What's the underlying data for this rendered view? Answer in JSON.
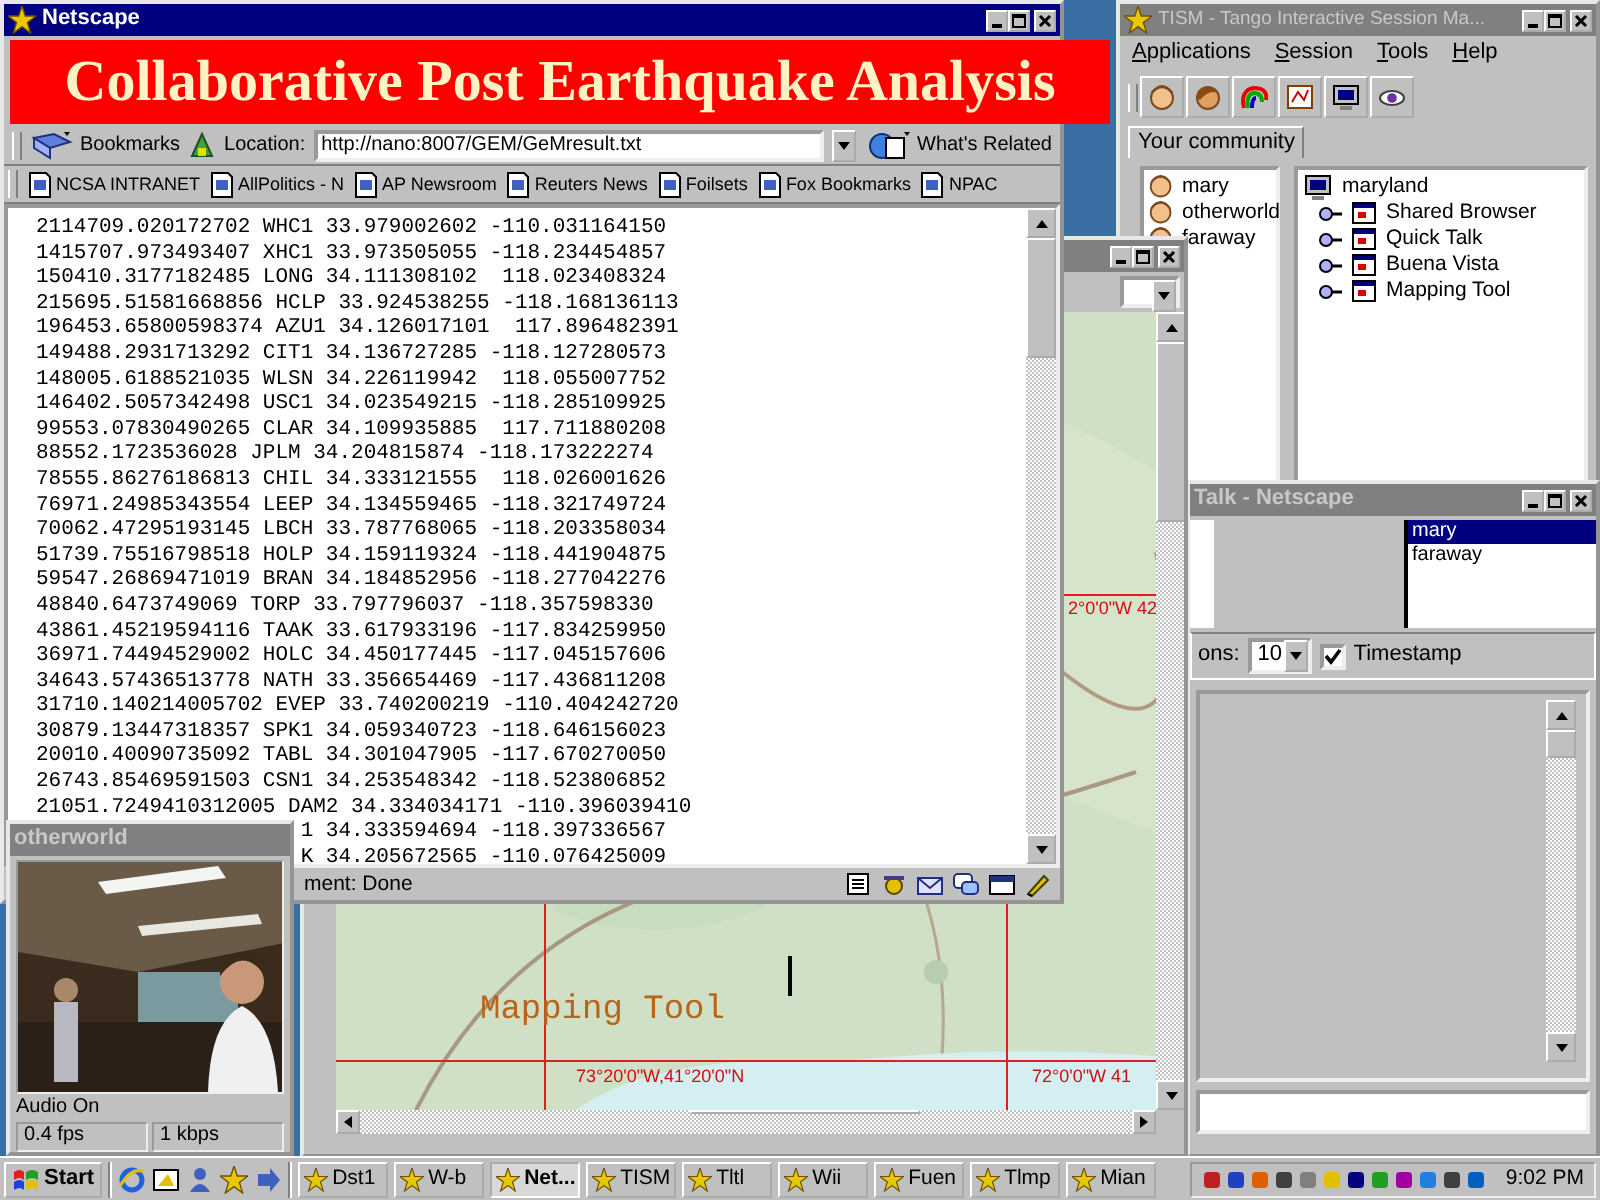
{
  "browser_window": {
    "title": "Netscape",
    "active": true,
    "banner": "Collaborative Post Earthquake Analysis",
    "toolbar": {
      "bookmarks": "Bookmarks",
      "location_label": "Location:",
      "url": "http://nano:8007/GEM/GeMresult.txt",
      "related": "What's Related"
    },
    "personal_toolbar": [
      "NCSA INTRANET",
      "AllPolitics - N",
      "AP Newsroom",
      "Reuters News",
      "Foilsets",
      "Fox Bookmarks",
      "NPAC"
    ],
    "lines": [
      {
        "kind": "full",
        "text": "2114709.020172702 WHC1 33.979002602 -110.031164150"
      },
      {
        "kind": "full",
        "text": "1415707.973493407 XHC1 33.973505055 -118.234454857"
      },
      {
        "kind": "full",
        "text": "150410.3177182485 LONG 34.111308102  118.023408324"
      },
      {
        "kind": "full",
        "text": "215695.51581668856 HCLP 33.924538255 -118.168136113"
      },
      {
        "kind": "full",
        "text": "196453.65800598374 AZU1 34.126017101  117.896482391"
      },
      {
        "kind": "full",
        "text": "149488.2931713292 CIT1 34.136727285 -118.127280573"
      },
      {
        "kind": "full",
        "text": "148005.6188521035 WLSN 34.226119942  118.055007752"
      },
      {
        "kind": "full",
        "text": "146402.5057342498 USC1 34.023549215 -118.285109925"
      },
      {
        "kind": "full",
        "text": "99553.07830490265 CLAR 34.109935885  117.711880208"
      },
      {
        "kind": "full",
        "text": "88552.1723536028 JPLM 34.204815874 -118.173222274"
      },
      {
        "kind": "full",
        "text": "78555.86276186813 CHIL 34.333121555  118.026001626"
      },
      {
        "kind": "full",
        "text": "76971.24985343554 LEEP 34.134559465 -118.321749724"
      },
      {
        "kind": "full",
        "text": "70062.47295193145 LBCH 33.787768065 -118.203358034"
      },
      {
        "kind": "full",
        "text": "51739.75516798518 HOLP 34.159119324 -118.441904875"
      },
      {
        "kind": "full",
        "text": "59547.26869471019 BRAN 34.184852956 -118.277042276"
      },
      {
        "kind": "full",
        "text": "48840.6473749069 TORP 33.797796037 -118.357598330"
      },
      {
        "kind": "full",
        "text": "43861.45219594116 TAAK 33.617933196 -117.834259950"
      },
      {
        "kind": "full",
        "text": "36971.74494529002 HOLC 34.450177445 -117.045157606"
      },
      {
        "kind": "full",
        "text": "34643.57436513778 NATH 33.356654469 -117.436811208"
      },
      {
        "kind": "full",
        "text": "31710.140214005702 EVEP 33.740200219 -110.404242720"
      },
      {
        "kind": "full",
        "text": "30879.13447318357 SPK1 34.059340723 -118.646156023"
      },
      {
        "kind": "full",
        "text": "20010.40090735092 TABL 34.301047905 -117.670270050"
      },
      {
        "kind": "full",
        "text": "26743.85469591503 CSN1 34.253548342 -118.523806852"
      },
      {
        "kind": "full",
        "text": "21051.7249410312005 DAM2 34.334034171 -110.396039410"
      },
      {
        "kind": "partial",
        "text": "1 34.333594694 -118.397336567"
      },
      {
        "kind": "partial",
        "text": "K 34.205672565 -110.076425009"
      }
    ],
    "status": "ment: Done"
  },
  "session_window": {
    "title": "TISM - Tango Interactive Session Ma...",
    "active": false,
    "menu": [
      "Applications",
      "Session",
      "Tools",
      "Help"
    ],
    "tab": {
      "label": "Your community",
      "selected": true
    },
    "people": [
      "mary",
      "otherworld",
      "faraway"
    ],
    "tree": [
      {
        "name": "maryland",
        "children": [
          {
            "name": "Shared Browser"
          },
          {
            "name": "Quick Talk"
          },
          {
            "name": "Buena Vista"
          },
          {
            "name": "Mapping Tool"
          }
        ]
      }
    ]
  },
  "map_window": {
    "active": false,
    "title_overlay": "Mapping Tool",
    "grid_labels": [
      "2°0'0\"W 42",
      "73°20'0\"W,41°20'0\"N",
      "72°0'0\"W 41"
    ]
  },
  "talk_window": {
    "title": "Talk - Netscape",
    "active": false,
    "users": [
      {
        "name": "mary",
        "selected": true
      },
      {
        "name": "faraway",
        "selected": false
      }
    ],
    "lines_label": "ons:",
    "lines_value": "10",
    "timestamp": {
      "label": "Timestamp",
      "checked": true
    }
  },
  "video_window": {
    "title": "otherworld",
    "active": false,
    "audio": "Audio On",
    "fps": "0.4 fps",
    "bandwidth": "1 kbps"
  },
  "taskbar": {
    "start": "Start",
    "tasks": [
      {
        "label": "Dst1",
        "selected": false
      },
      {
        "label": "W-b",
        "selected": false
      },
      {
        "label": "Net...",
        "selected": true
      },
      {
        "label": "TISM",
        "selected": false
      },
      {
        "label": "Tltl",
        "selected": false
      },
      {
        "label": "Wii",
        "selected": false
      },
      {
        "label": "Fuen",
        "selected": false
      },
      {
        "label": "Tlmp",
        "selected": false
      },
      {
        "label": "Mian",
        "selected": false
      }
    ],
    "clock": "9:02 PM"
  }
}
